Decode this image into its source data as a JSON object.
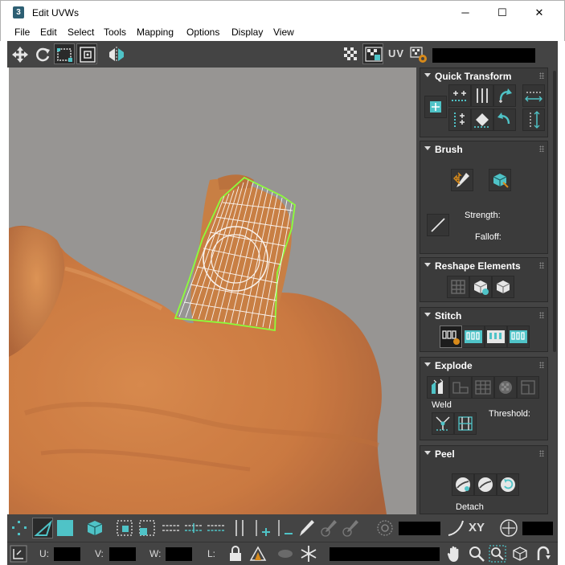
{
  "window": {
    "app_icon_text": "3",
    "title": "Edit UVWs",
    "minimize": "─",
    "maximize": "☐",
    "close": "✕"
  },
  "menu": [
    "File",
    "Edit",
    "Select",
    "Tools",
    "Mapping",
    "Options",
    "Display",
    "View"
  ],
  "toolbar_top": {
    "uv_label": "UV",
    "uv_field_value": ""
  },
  "panel": {
    "quick_transform": {
      "title": "Quick Transform"
    },
    "brush": {
      "title": "Brush",
      "strength_label": "Strength:",
      "falloff_label": "Falloff:"
    },
    "reshape": {
      "title": "Reshape Elements"
    },
    "stitch": {
      "title": "Stitch"
    },
    "explode": {
      "title": "Explode",
      "weld_label": "Weld",
      "threshold_label": "Threshold:"
    },
    "peel": {
      "title": "Peel",
      "detach_label": "Detach"
    }
  },
  "toolbar_bottom": {
    "xy_label": "XY",
    "field1_value": "",
    "field2_value": ""
  },
  "status": {
    "u_label": "U:",
    "v_label": "V:",
    "w_label": "W:",
    "l_label": "L:",
    "u_value": "",
    "v_value": "",
    "w_value": "",
    "l_value": ""
  },
  "colors": {
    "accent_teal": "#4fc3c7",
    "mesh_green": "#7fd13b",
    "panel_bg": "#444444",
    "rollout_bg": "#3b3b3b"
  }
}
